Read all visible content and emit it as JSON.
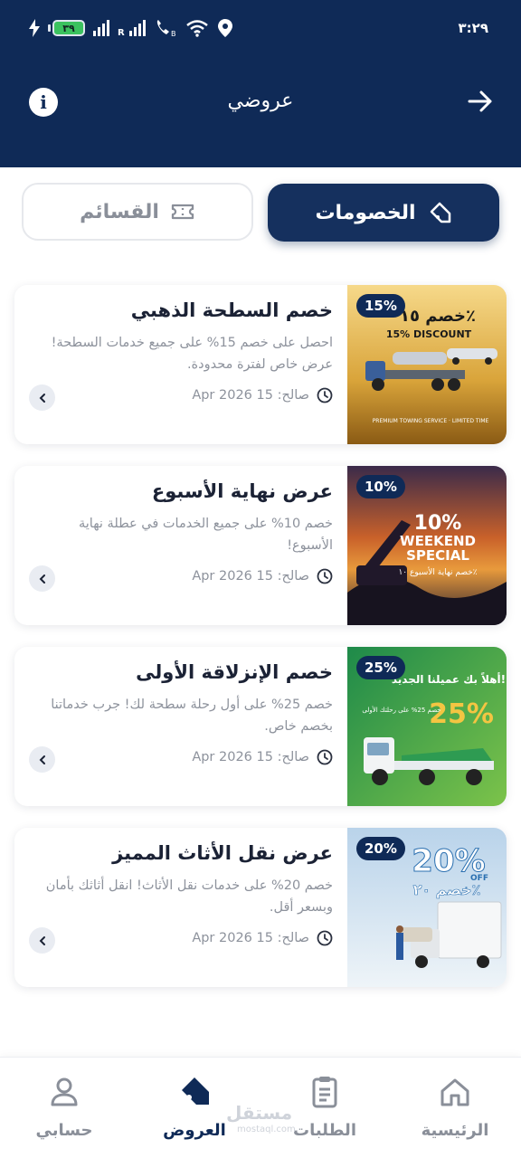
{
  "status": {
    "time": "٣:٢٩",
    "battery": "٣٩"
  },
  "header": {
    "title": "عروضي"
  },
  "tabs": [
    {
      "label": "الخصومات",
      "icon": "tag-icon",
      "active": true
    },
    {
      "label": "القسائم",
      "icon": "ticket-icon",
      "active": false
    }
  ],
  "offers": [
    {
      "badge": "15%",
      "title": "خصم السطحة الذهبي",
      "description": "احصل على خصم 15% على جميع خدمات السطحة! عرض خاص لفترة محدودة.",
      "date": "صالح: 15 Apr 2026",
      "image_text": [
        "خصم ١٥٪",
        "15% DISCOUNT",
        "PREMIUM TOWING SERVICE · LIMITED TIME"
      ]
    },
    {
      "badge": "10%",
      "title": "عرض نهاية الأسبوع",
      "description": "خصم 10% على جميع الخدمات في عطلة نهاية الأسبوع!",
      "date": "صالح: 15 Apr 2026",
      "image_text": [
        "10%",
        "WEEKEND",
        "SPECIAL",
        "خصم نهاية الأسبوع ١٠٪"
      ]
    },
    {
      "badge": "25%",
      "title": "خصم الإنزلاقة الأولى",
      "description": "خصم 25% على أول رحلة سطحة لك! جرب خدماتنا بخصم خاص.",
      "date": "صالح: 15 Apr 2026",
      "image_text": [
        "أهلاً بك عميلنا الجديد!",
        "25%",
        "خصم 25% على رحلتك الأولى"
      ]
    },
    {
      "badge": "20%",
      "title": "عرض نقل الأثاث المميز",
      "description": "خصم 20% على خدمات نقل الأثاث! انقل أثاثك بأمان وبسعر أقل.",
      "date": "صالح: 15 Apr 2026",
      "image_text": [
        "20%",
        "OFF",
        "خصم ٢٠٪"
      ]
    }
  ],
  "nav": [
    {
      "label": "الرئيسية",
      "icon": "home-icon",
      "active": false
    },
    {
      "label": "الطلبات",
      "icon": "clipboard-icon",
      "active": false
    },
    {
      "label": "العروض",
      "icon": "tag-icon",
      "active": true
    },
    {
      "label": "حسابي",
      "icon": "user-icon",
      "active": false
    }
  ],
  "watermark": {
    "text": "مستقل",
    "sub": "mostaql.com"
  },
  "colors": {
    "primary": "#0f2a57",
    "muted": "#8d929c",
    "battery": "#3bc25f"
  }
}
